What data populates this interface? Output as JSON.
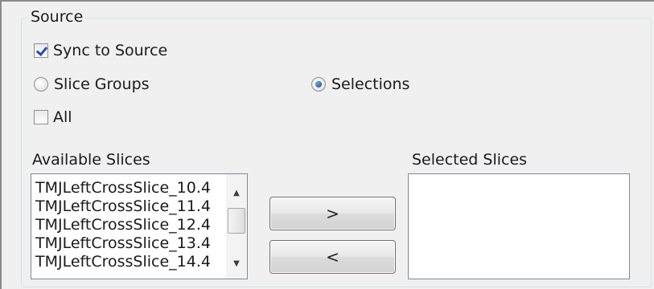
{
  "groupbox": {
    "title": "Source"
  },
  "options": {
    "sync_to_source": {
      "label": "Sync to Source",
      "checked": true
    },
    "slice_groups": {
      "label": "Slice Groups",
      "selected": false
    },
    "selections": {
      "label": "Selections",
      "selected": true
    },
    "all": {
      "label": "All",
      "checked": false
    }
  },
  "available": {
    "label": "Available Slices",
    "items": [
      "TMJLeftCrossSlice_10.4",
      "TMJLeftCrossSlice_11.4",
      "TMJLeftCrossSlice_12.4",
      "TMJLeftCrossSlice_13.4",
      "TMJLeftCrossSlice_14.4"
    ]
  },
  "selected": {
    "label": "Selected Slices",
    "items": []
  },
  "buttons": {
    "add_label": ">",
    "remove_label": "<"
  },
  "icons": {
    "scroll_up": "scroll-up-arrow",
    "scroll_down": "scroll-down-arrow"
  }
}
